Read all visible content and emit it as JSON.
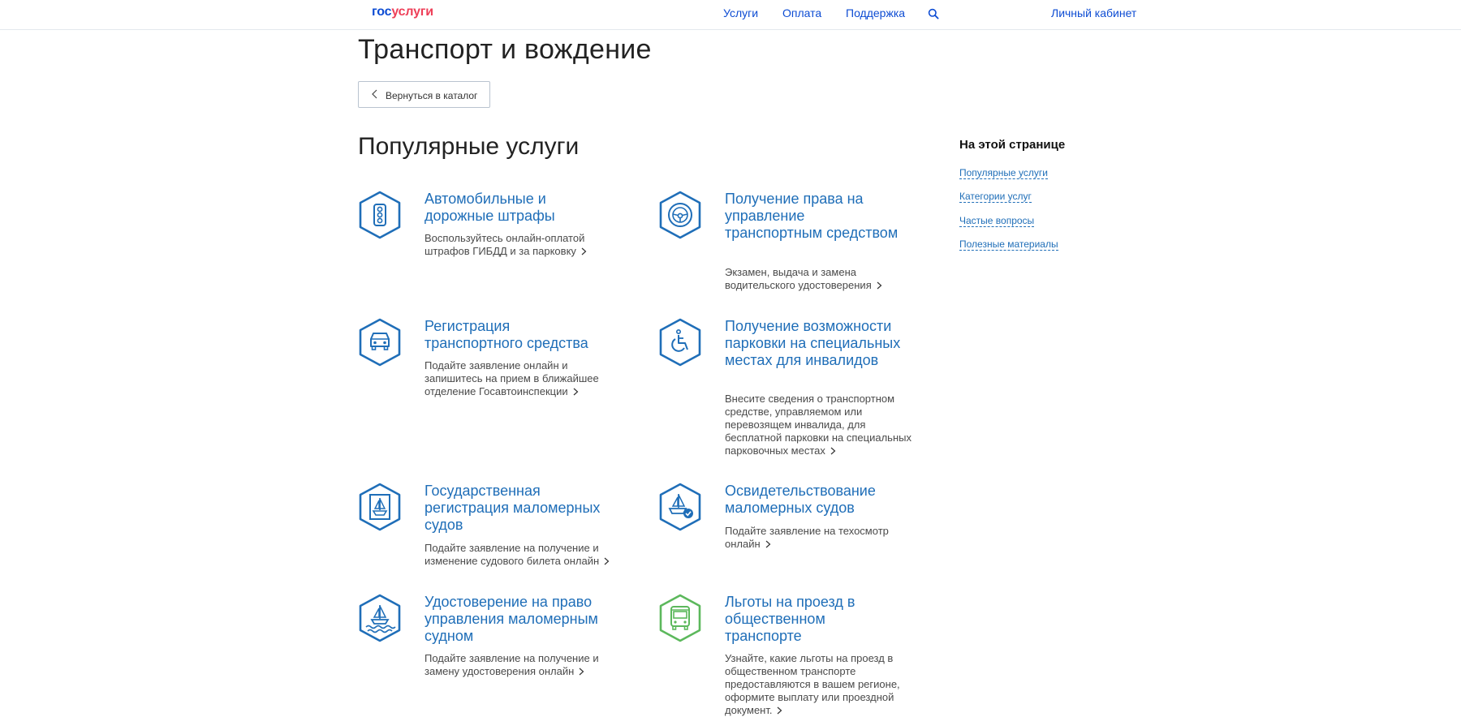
{
  "header": {
    "logo_part1": "гос",
    "logo_part2": "услуги",
    "nav": [
      "Услуги",
      "Оплата",
      "Поддержка"
    ],
    "search_icon": "search-icon",
    "cabinet": "Личный кабинет"
  },
  "page": {
    "title": "Транспорт и вождение",
    "back_label": "Вернуться в каталог",
    "section_title": "Популярные услуги"
  },
  "services": [
    {
      "title": "Автомобильные и дорожные штрафы",
      "desc": "Воспользуйтесь онлайн-оплатой штрафов ГИБДД и за парковку",
      "icon": "traffic-light-icon",
      "color": "#1f6eb8"
    },
    {
      "title": "Получение права на управление транспортным средством",
      "desc": "Экзамен, выдача и замена водительского удостоверения",
      "icon": "steering-wheel-icon",
      "color": "#1f6eb8"
    },
    {
      "title": "Регистрация транспортного средства",
      "desc": "Подайте заявление онлайн и запишитесь на прием в ближайшее отделение Госавтоинспекции",
      "icon": "car-icon",
      "color": "#1f6eb8"
    },
    {
      "title": "Получение возможности парковки на специальных местах для инвалидов",
      "desc": "Внесите сведения о транспортном средстве, управляемом или перевозящем инвалида, для бесплатной парковки на специальных парковочных местах",
      "icon": "wheelchair-icon",
      "color": "#1f6eb8"
    },
    {
      "title": "Государственная регистрация маломерных судов",
      "desc": "Подайте заявление на получение и изменение судового билета онлайн",
      "icon": "boat-document-icon",
      "color": "#1f6eb8"
    },
    {
      "title": "Освидетельствование маломерных судов",
      "desc": "Подайте заявление на техосмотр онлайн",
      "icon": "boat-check-icon",
      "color": "#1f6eb8"
    },
    {
      "title": "Удостоверение на право управления маломерным судном",
      "desc": "Подайте заявление на получение и замену удостоверения онлайн",
      "icon": "boat-waves-icon",
      "color": "#1f6eb8"
    },
    {
      "title": "Льготы на проезд в общественном транспорте",
      "desc": "Узнайте, какие льготы на проезд в общественном транспорте предоставляются в вашем регионе, оформите выплату или проездной документ.",
      "icon": "bus-icon",
      "color": "#5cb85c"
    }
  ],
  "toc": {
    "title": "На этой странице",
    "links": [
      "Популярные услуги",
      "Категории услуг",
      "Частые вопросы",
      "Полезные материалы"
    ]
  }
}
